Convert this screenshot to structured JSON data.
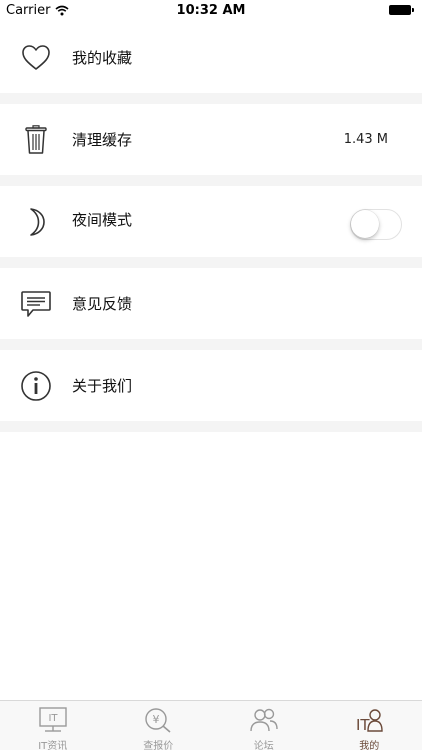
{
  "status_bar": {
    "carrier": "Carrier",
    "time": "10:32 AM"
  },
  "menu": {
    "favorites_label": "我的收藏",
    "clear_cache_label": "清理缓存",
    "cache_size": "1.43 M",
    "night_mode_label": "夜间模式",
    "night_mode_on": false,
    "feedback_label": "意见反馈",
    "about_label": "关于我们"
  },
  "tabs": [
    {
      "label": "IT资讯",
      "icon": "monitor-it-icon",
      "active": false
    },
    {
      "label": "查报价",
      "icon": "yen-search-icon",
      "active": false
    },
    {
      "label": "论坛",
      "icon": "people-icon",
      "active": false
    },
    {
      "label": "我的",
      "icon": "it-person-icon",
      "active": true
    }
  ],
  "colors": {
    "accent": "#6b4a3a",
    "separator": "#f4f4f4",
    "tab_inactive": "#999999"
  }
}
